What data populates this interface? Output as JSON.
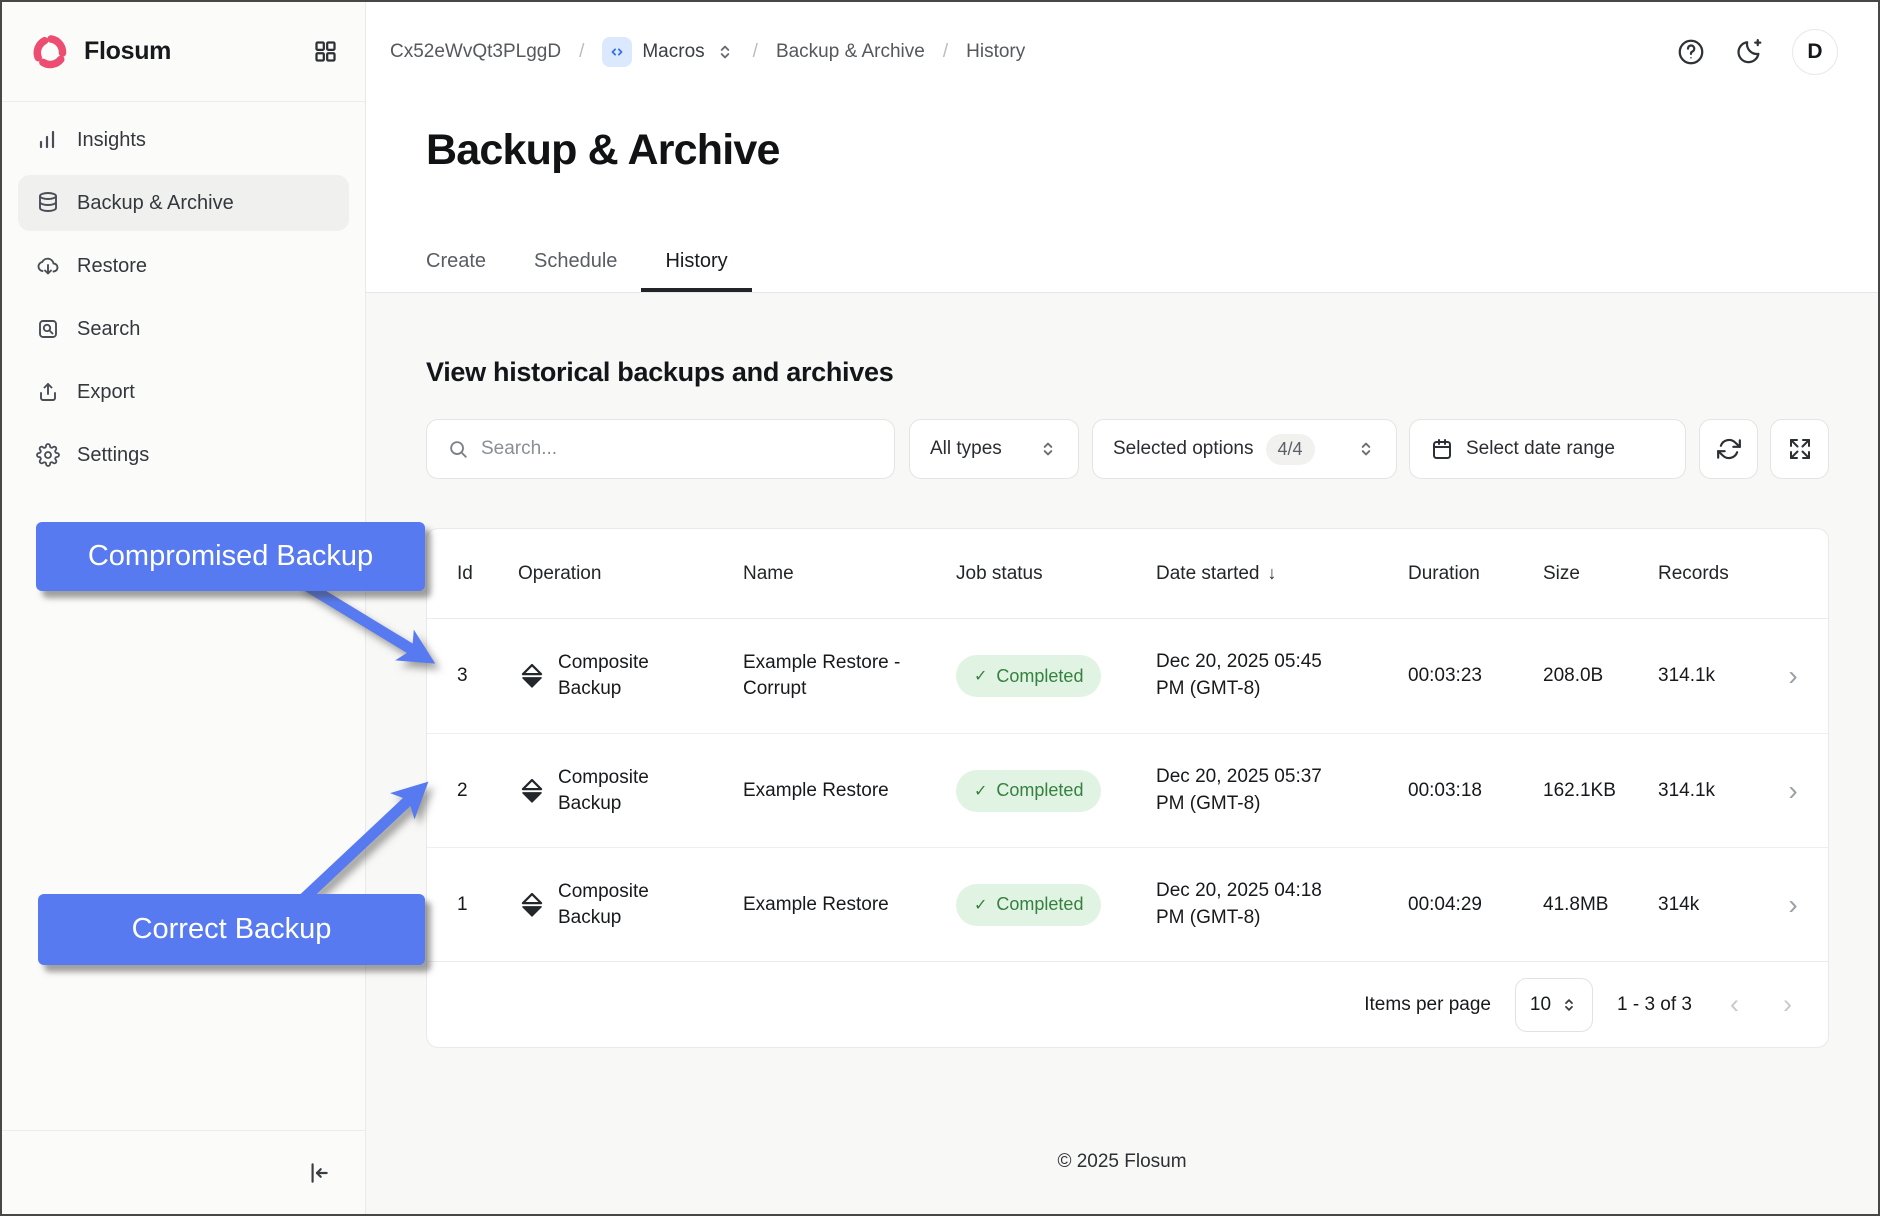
{
  "sidebar": {
    "brand": "Flosum",
    "items": [
      {
        "label": "Insights"
      },
      {
        "label": "Backup & Archive",
        "active": true
      },
      {
        "label": "Restore"
      },
      {
        "label": "Search"
      },
      {
        "label": "Export"
      },
      {
        "label": "Settings"
      }
    ]
  },
  "breadcrumb": {
    "org_id": "Cx52eWvQt3PLggD",
    "sep": "/",
    "app": "Macros",
    "section": "Backup & Archive",
    "page": "History"
  },
  "topbar": {
    "avatar_initial": "D"
  },
  "page": {
    "title": "Backup & Archive",
    "tabs": [
      {
        "label": "Create"
      },
      {
        "label": "Schedule"
      },
      {
        "label": "History",
        "active": true
      }
    ],
    "section_title": "View historical backups and archives"
  },
  "filters": {
    "search_placeholder": "Search...",
    "type_select": "All types",
    "options_select": "Selected options",
    "options_count": "4/4",
    "date_range": "Select date range"
  },
  "table": {
    "columns": [
      "Id",
      "Operation",
      "Name",
      "Job status",
      "Date started",
      "Duration",
      "Size",
      "Records"
    ],
    "sorted_by": "Date started",
    "rows": [
      {
        "id": "3",
        "operation": "Composite Backup",
        "name": "Example Restore - Corrupt",
        "status": "Completed",
        "date": "Dec 20, 2025 05:45 PM (GMT-8)",
        "duration": "00:03:23",
        "size": "208.0B",
        "records": "314.1k"
      },
      {
        "id": "2",
        "operation": "Composite Backup",
        "name": "Example Restore",
        "status": "Completed",
        "date": "Dec 20, 2025 05:37 PM (GMT-8)",
        "duration": "00:03:18",
        "size": "162.1KB",
        "records": "314.1k"
      },
      {
        "id": "1",
        "operation": "Composite Backup",
        "name": "Example Restore",
        "status": "Completed",
        "date": "Dec 20, 2025 04:18 PM (GMT-8)",
        "duration": "00:04:29",
        "size": "41.8MB",
        "records": "314k"
      }
    ]
  },
  "pagination": {
    "items_per_page_label": "Items per page",
    "items_per_page": "10",
    "range": "1 - 3 of 3"
  },
  "glyphs": {
    "sort_desc": "↓",
    "check": "✓",
    "row_chevron": "›",
    "prev": "‹",
    "next": "›"
  },
  "annotations": {
    "compromised": "Compromised Backup",
    "correct": "Correct Backup",
    "accent_color": "#587af0"
  },
  "footer": {
    "copyright": "© 2025 Flosum"
  },
  "colors": {
    "badge_bg": "#e1f3e2",
    "badge_text": "#35813f",
    "brand_pink": "#ec4d70",
    "accent_blue": "#587af0"
  }
}
